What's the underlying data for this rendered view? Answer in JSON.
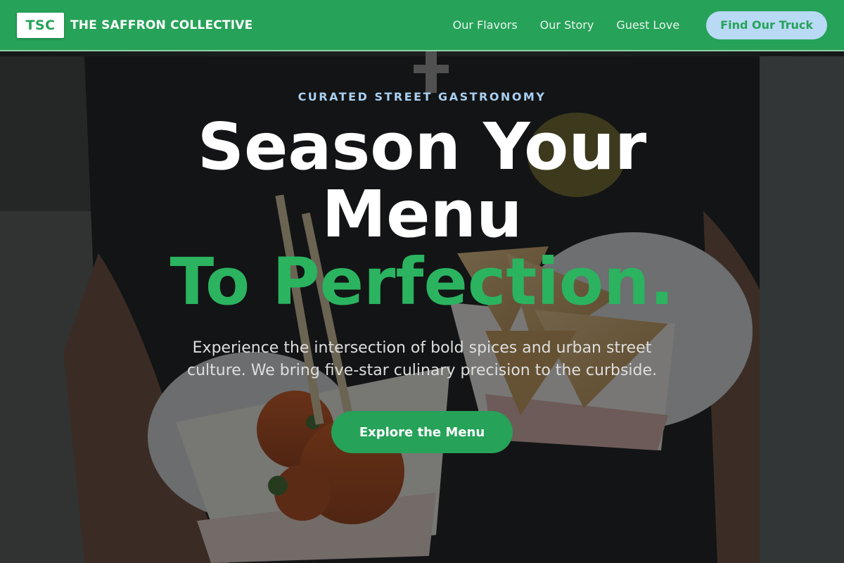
{
  "header": {
    "logo_text": "TSC",
    "brand_name": "THE SAFFRON COLLECTIVE",
    "nav_links": [
      "Our Flavors",
      "Our Story",
      "Guest Love"
    ],
    "cta_label": "Find Our Truck"
  },
  "hero": {
    "eyebrow": "CURATED STREET GASTRONOMY",
    "headline_line1": "Season Your Menu",
    "headline_accent": "To Perfection.",
    "subtext": "Experience the intersection of bold spices and urban street culture. We bring five-star culinary precision to the curbside.",
    "cta_label": "Explore the Menu"
  },
  "colors": {
    "brand_green": "#26a259",
    "accent_green": "#2bb360",
    "eyebrow_blue": "#a9d0f0",
    "cta_blue": "#b9daf5"
  }
}
